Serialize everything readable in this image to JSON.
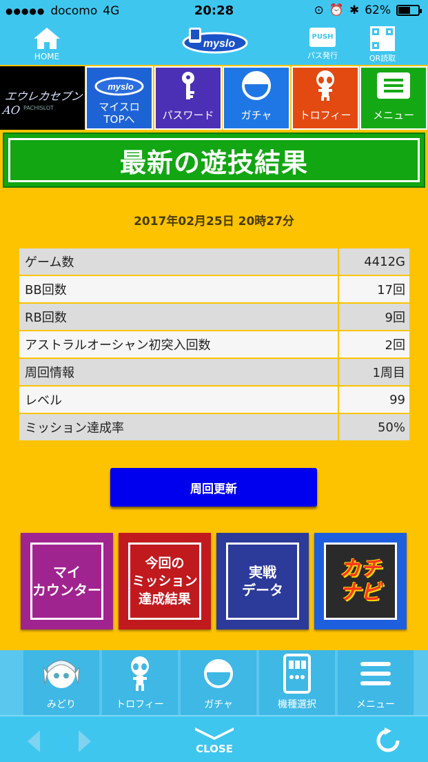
{
  "statusbar": {
    "carrier": "docomo",
    "network": "4G",
    "time": "20:28",
    "battery": "62%",
    "battery_level": 0.62
  },
  "topnav": {
    "home_label": "HOME",
    "logo_text": "myslo",
    "pass_label": "パス発行",
    "pass_badge": "PUSH",
    "qr_label": "QR読取"
  },
  "game": {
    "title": "エウレカセブンAO",
    "subtitle": "PACHISLOT"
  },
  "tiles": [
    {
      "label": "マイスロ\nTOPへ",
      "icon": "myslo-logo-icon",
      "color": "#1e63d6"
    },
    {
      "label": "パスワード",
      "icon": "key-icon",
      "color": "#4b2fb5"
    },
    {
      "label": "ガチャ",
      "icon": "capsule-icon",
      "color": "#1f77e6"
    },
    {
      "label": "トロフィー",
      "icon": "alien-icon",
      "color": "#e24a12"
    },
    {
      "label": "メニュー",
      "icon": "menu-icon",
      "color": "#15a815"
    }
  ],
  "banner": {
    "title": "最新の遊技結果"
  },
  "play": {
    "date": "2017年02月25日 20時27分",
    "rows": [
      {
        "label": "ゲーム数",
        "value": "4412G"
      },
      {
        "label": "BB回数",
        "value": "17回"
      },
      {
        "label": "RB回数",
        "value": "9回"
      },
      {
        "label": "アストラルオーシャン初突入回数",
        "value": "2回"
      },
      {
        "label": "周回情報",
        "value": "1周目"
      },
      {
        "label": "レベル",
        "value": "99"
      },
      {
        "label": "ミッション達成率",
        "value": "50%"
      }
    ],
    "update_button": "周回更新"
  },
  "bigtiles": [
    {
      "label": "マイ\nカウンター",
      "color": "#a0248f"
    },
    {
      "label": "今回の\nミッション\n達成結果",
      "color": "#c01a1e"
    },
    {
      "label": "実戦\nデータ",
      "color": "#2c3a9a"
    },
    {
      "label": "カチ\nナビ",
      "color": "#1e5fe0"
    }
  ],
  "bottombar": [
    {
      "label": "みどり",
      "icon": "character-icon"
    },
    {
      "label": "トロフィー",
      "icon": "alien-icon"
    },
    {
      "label": "ガチャ",
      "icon": "capsule-icon"
    },
    {
      "label": "機種選択",
      "icon": "slot-machine-icon"
    },
    {
      "label": "メニュー",
      "icon": "menu-icon"
    }
  ],
  "footer": {
    "close_label": "CLOSE"
  }
}
